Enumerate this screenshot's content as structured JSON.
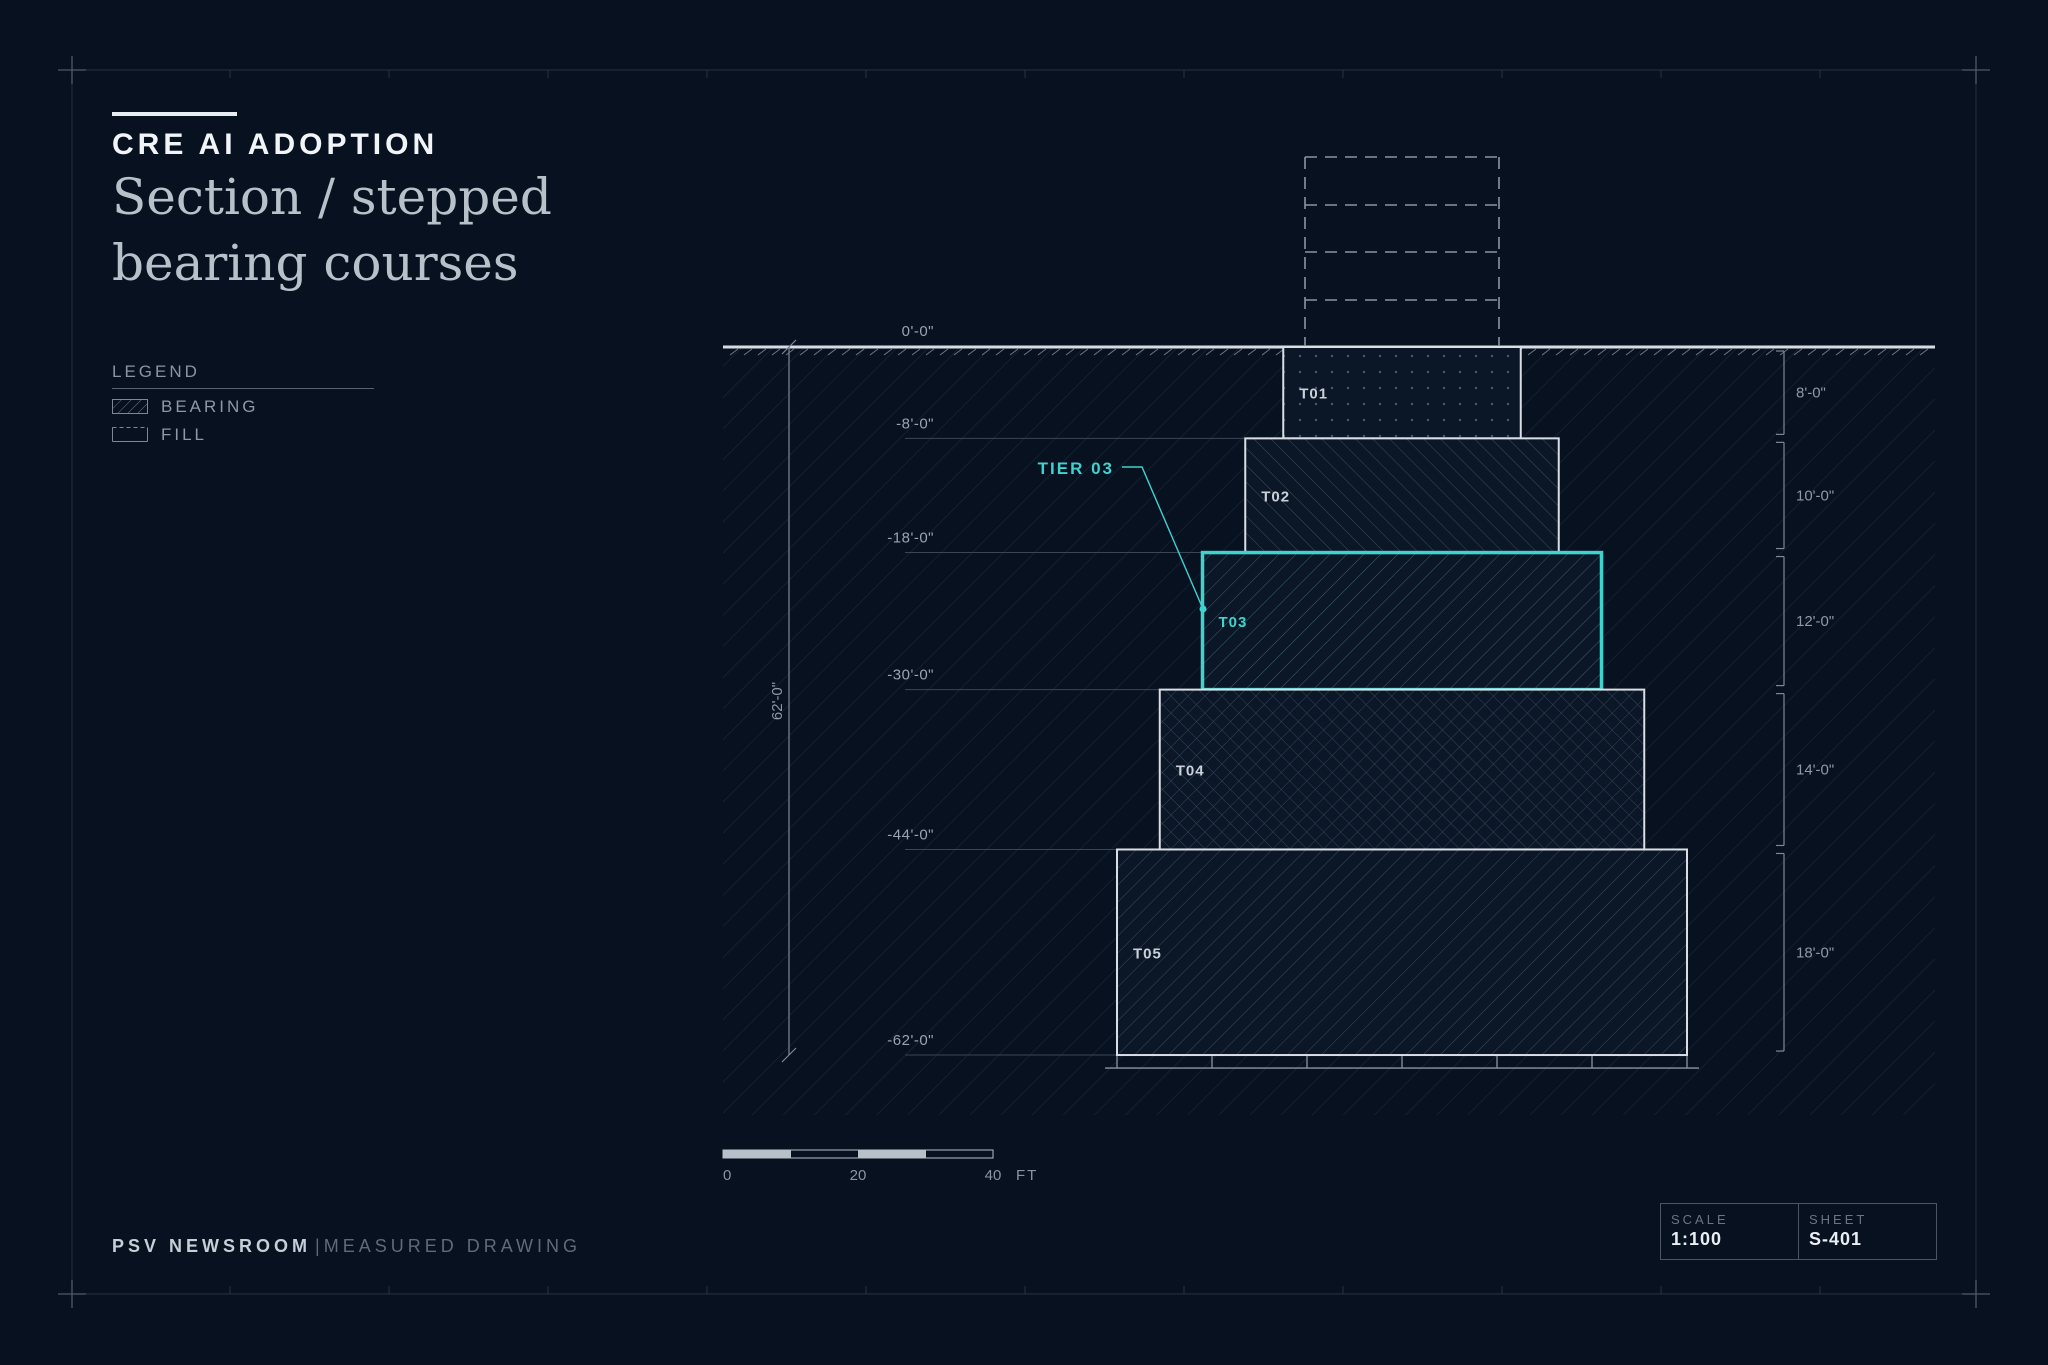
{
  "header": {
    "kicker": "CRE AI ADOPTION",
    "title_line1": "Section / stepped",
    "title_line2": "bearing courses"
  },
  "legend": {
    "title": "LEGEND",
    "items": [
      {
        "label": "BEARING",
        "swatch": "hatch"
      },
      {
        "label": "FILL",
        "swatch": "dashed-top"
      }
    ]
  },
  "drawing": {
    "grade_label": "0'-0\"",
    "total_depth_label": "62'-0\"",
    "callout": "TIER 03",
    "highlight_tier": "T03",
    "tiers": [
      {
        "id": "T01",
        "top_ft": 0,
        "bottom_ft": 8,
        "width_ft": 25,
        "thickness": "8'-0\"",
        "depth_label": "-8'-0\"",
        "pattern": "dots"
      },
      {
        "id": "T02",
        "top_ft": 8,
        "bottom_ft": 18,
        "width_ft": 33,
        "thickness": "10'-0\"",
        "depth_label": "-18'-0\"",
        "pattern": "backslash"
      },
      {
        "id": "T03",
        "top_ft": 18,
        "bottom_ft": 30,
        "width_ft": 42,
        "thickness": "12'-0\"",
        "depth_label": "-30'-0\"",
        "pattern": "slash"
      },
      {
        "id": "T04",
        "top_ft": 30,
        "bottom_ft": 44,
        "width_ft": 51,
        "thickness": "14'-0\"",
        "depth_label": "-44'-0\"",
        "pattern": "cross"
      },
      {
        "id": "T05",
        "top_ft": 44,
        "bottom_ft": 62,
        "width_ft": 60,
        "thickness": "18'-0\"",
        "depth_label": "-62'-0\"",
        "pattern": "slash"
      }
    ],
    "colors": {
      "background": "#07111f",
      "line": "#d9dee4",
      "accent": "#3fd3d0",
      "muted": "#8a95a3"
    }
  },
  "scale_bar": {
    "ticks": [
      "0",
      "20",
      "40"
    ],
    "unit": "FT"
  },
  "footer": {
    "brand": "PSV NEWSROOM",
    "separator": "|",
    "subtitle": "MEASURED DRAWING"
  },
  "title_block": {
    "scale_label": "SCALE",
    "scale_value": "1:100",
    "sheet_label": "SHEET",
    "sheet_value": "S-401"
  }
}
